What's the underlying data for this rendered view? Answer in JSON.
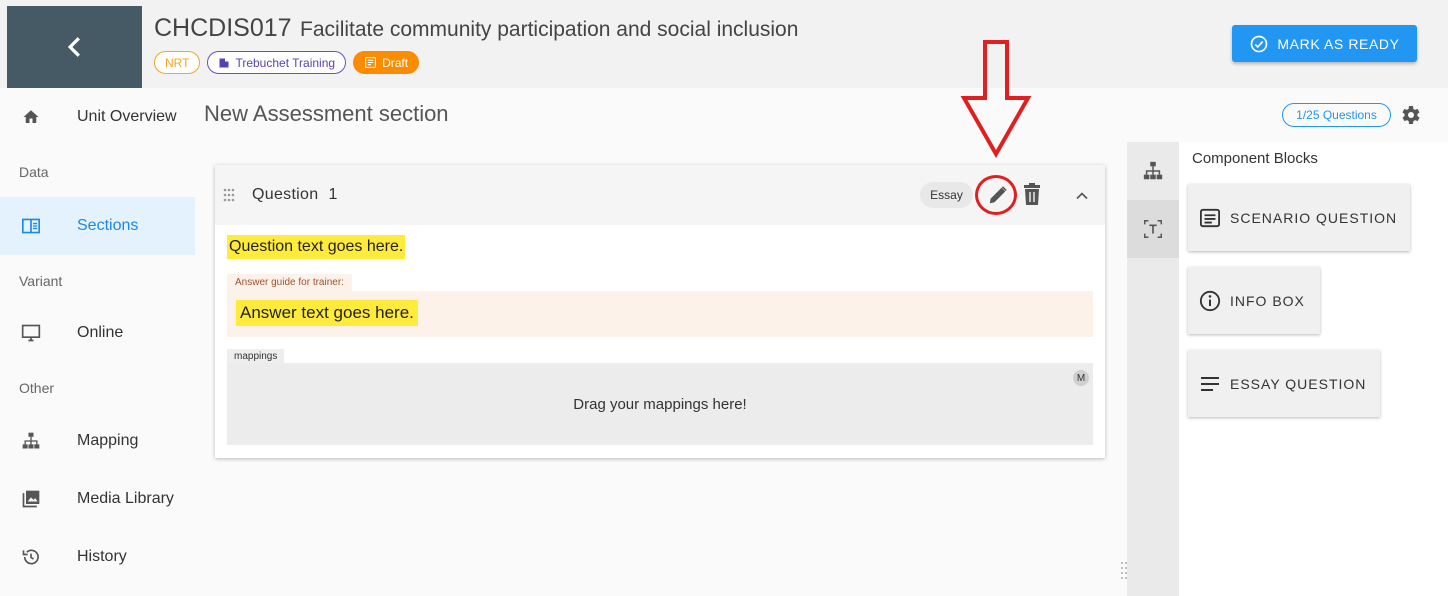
{
  "header": {
    "title_code": "CHCDIS017",
    "title_name": "Facilitate community participation and social inclusion",
    "chips": {
      "nrt": "NRT",
      "org": "Trebuchet Training",
      "status": "Draft"
    },
    "ready_button": "MARK AS READY"
  },
  "sidebar": {
    "items": {
      "overview": "Unit Overview",
      "sections": "Sections",
      "online": "Online",
      "mapping": "Mapping",
      "media": "Media Library",
      "history": "History"
    },
    "headings": {
      "data": "Data",
      "variant": "Variant",
      "other": "Other"
    }
  },
  "main": {
    "section_title": "New Assessment section",
    "question_count": "1/25 Questions",
    "question": {
      "label": "Question",
      "number": "1",
      "type": "Essay",
      "text": "Question text goes here.",
      "guide_label": "Answer guide for trainer:",
      "answer_text": "Answer text goes here.",
      "mappings_label": "mappings",
      "mappings_placeholder": "Drag your mappings here!",
      "mappings_badge": "M"
    }
  },
  "right_panel": {
    "title": "Component Blocks",
    "blocks": {
      "scenario": "SCENARIO QUESTION",
      "info": "INFO BOX",
      "essay": "ESSAY QUESTION"
    }
  },
  "colors": {
    "primary": "#2196f3",
    "header_dark": "#455a64",
    "draft": "#fb8c00",
    "highlight": "#ffeb3b",
    "annotation": "#e02020"
  }
}
